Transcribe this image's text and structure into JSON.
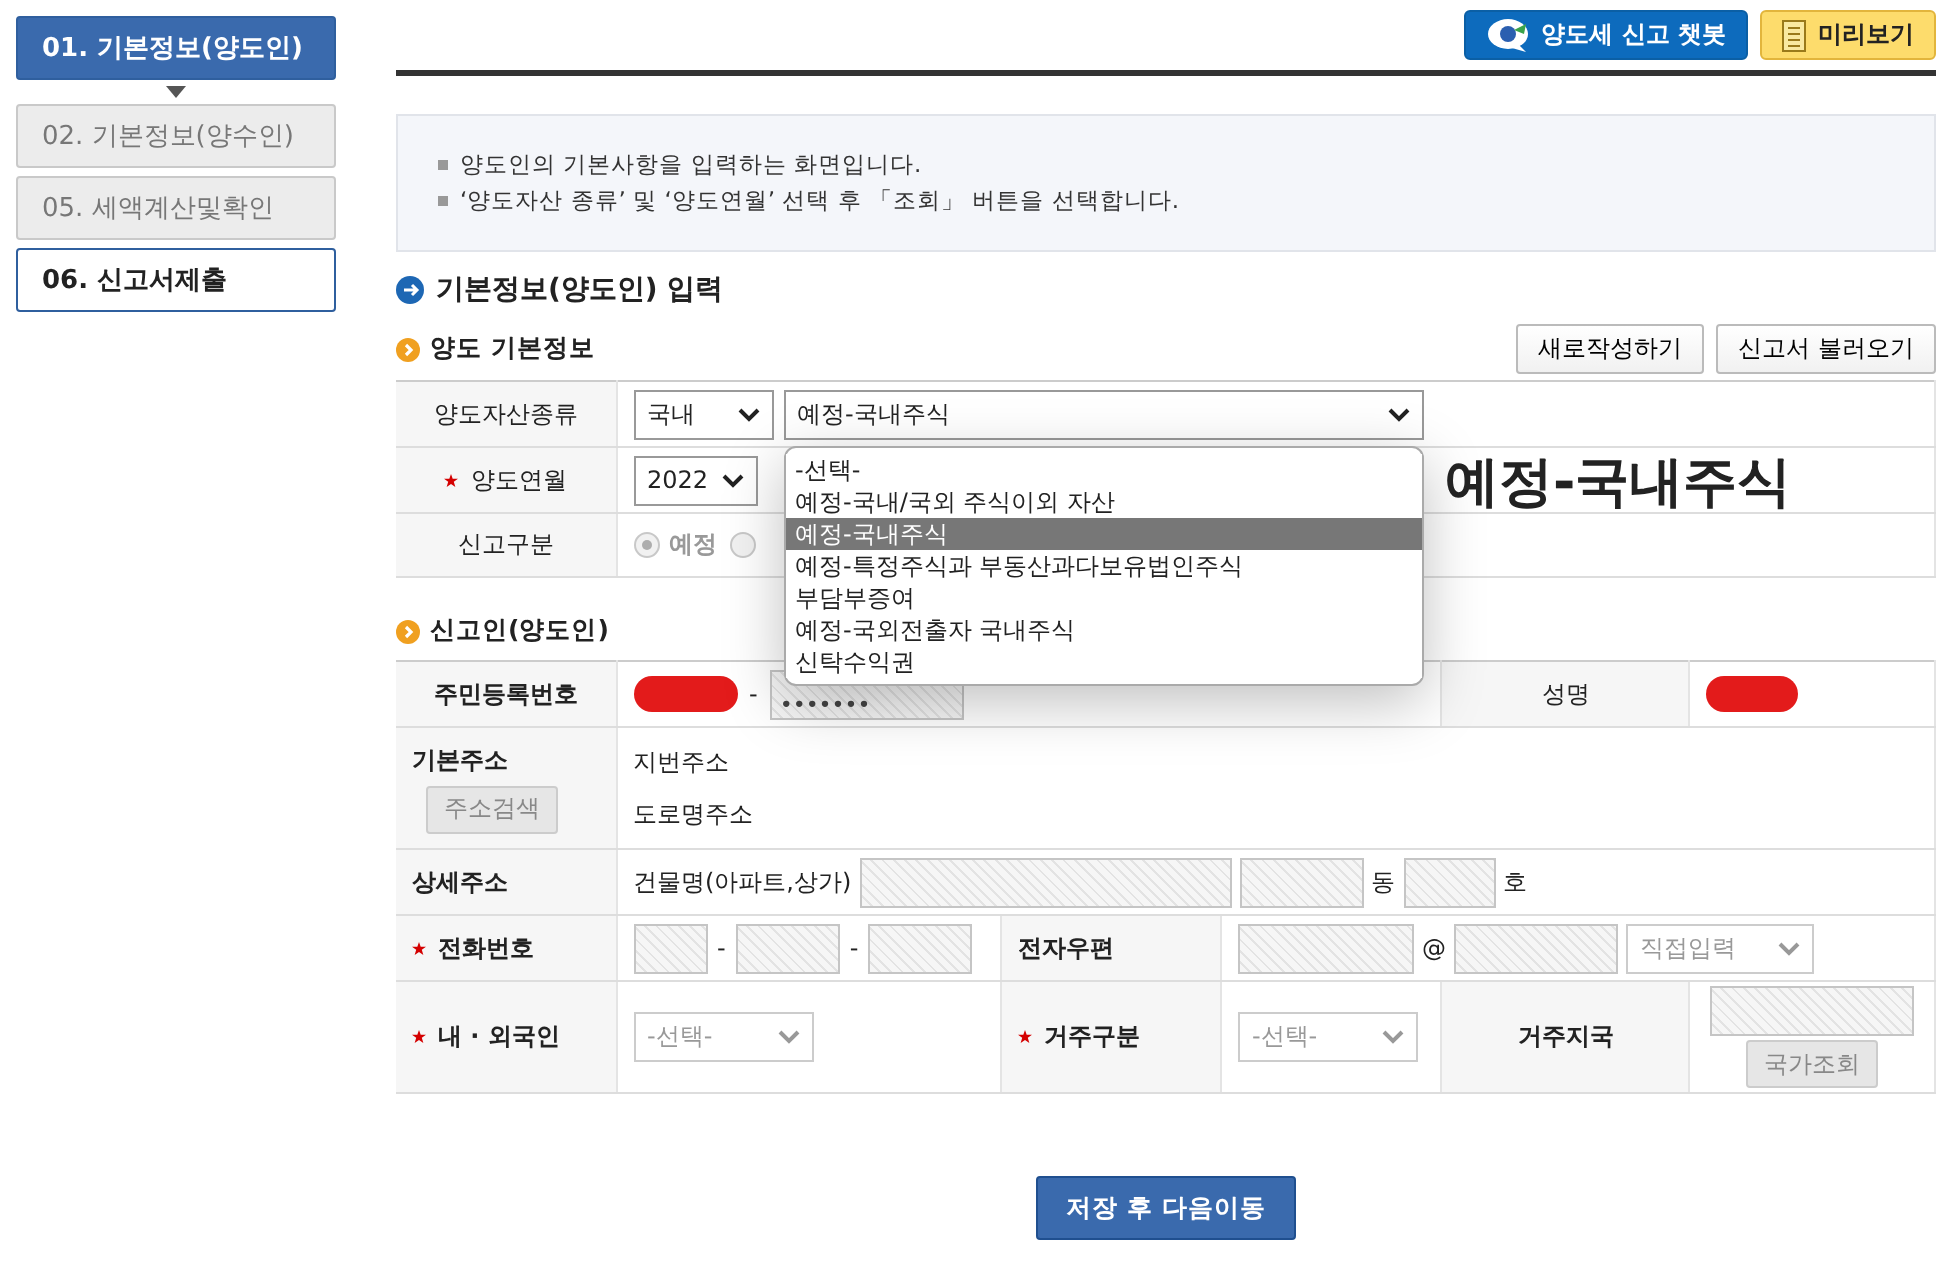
{
  "top_buttons": [
    {
      "kind": "chatbot",
      "label": "양도세 신고 챗봇"
    },
    {
      "kind": "preview",
      "label": "미리보기"
    }
  ],
  "sidebar": {
    "steps": [
      {
        "label": "01. 기본정보(양도인)",
        "selected": true,
        "disabled": false
      },
      {
        "label": "02. 기본정보(양수인)",
        "selected": false,
        "disabled": true
      },
      {
        "label": "05. 세액계산및확인",
        "selected": false,
        "disabled": true
      },
      {
        "label": "06. 신고서제출",
        "selected": false,
        "disabled": false
      }
    ]
  },
  "notice": [
    "양도인의 기본사항을 입력하는 화면입니다.",
    "‘양도자산 종류’ 및 ‘양도연월’ 선택 후 「조회」 버튼을 선택합니다."
  ],
  "section_title": "기본정보(양도인) 입력",
  "transfer": {
    "title": "양도 기본정보",
    "buttons": [
      "새로작성하기",
      "신고서 불러오기"
    ],
    "asset_type": {
      "label": "양도자산종류",
      "region": "국내",
      "value": "예정-국내주식",
      "expanded": true,
      "options": [
        {
          "label": "-선택-",
          "selected": false
        },
        {
          "label": "예정-국내/국외 주식이외 자산",
          "selected": false
        },
        {
          "label": "예정-국내주식",
          "selected": true
        },
        {
          "label": "예정-특정주식과 부동산과다보유법인주식",
          "selected": false
        },
        {
          "label": "부담부증여",
          "selected": false
        },
        {
          "label": "예정-국외전출자 국내주식",
          "selected": false
        },
        {
          "label": "신탁수익권",
          "selected": false
        }
      ]
    },
    "month": {
      "label": "양도연월",
      "required": true,
      "year": "2022"
    },
    "report_type": {
      "label": "신고구분",
      "options": [
        {
          "label": "예정",
          "selected": true,
          "disabled": true
        },
        {
          "selected": false,
          "disabled": true
        }
      ]
    }
  },
  "overlay_text": "예정-국내주식",
  "filer": {
    "title": "신고인(양도인)",
    "rrn": {
      "label": "주민등록번호",
      "separator": "-",
      "masked": "•••••••"
    },
    "name": {
      "label": "성명"
    },
    "address": {
      "label": "기본주소",
      "search_button": "주소검색",
      "lot": "지번주소",
      "road": "도로명주소"
    },
    "detail": {
      "label": "상세주소",
      "building": "건물명(아파트,상가)",
      "dong": "동",
      "ho": "호"
    },
    "phone": {
      "label": "전화번호",
      "required": true,
      "separators": [
        "-",
        "-"
      ]
    },
    "email": {
      "label": "전자우편",
      "at": "@",
      "domain_placeholder": "직접입력"
    },
    "nationality": {
      "label": "내 · 외국인",
      "required": true,
      "placeholder": "-선택-"
    },
    "residence": {
      "label": "거주구분",
      "required": true,
      "placeholder": "-선택-"
    },
    "country": {
      "label": "거주지국",
      "button": "국가조회"
    }
  },
  "save_button": "저장 후 다음이동"
}
